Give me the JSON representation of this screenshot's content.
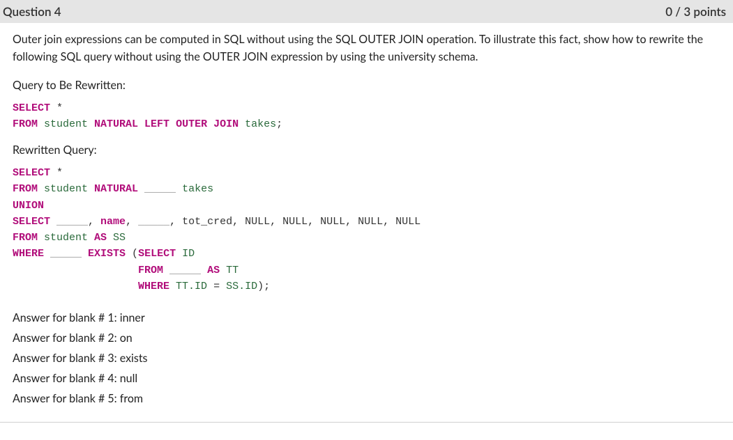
{
  "header": {
    "title": "Question 4",
    "points": "0 / 3 points"
  },
  "prompt": "Outer join expressions can be computed in SQL without using the SQL OUTER JOIN operation.  To illustrate this fact, show how to rewrite the following SQL query without using the OUTER JOIN expression by using the university schema.",
  "labels": {
    "original": "Query to Be Rewritten:",
    "rewritten": "Rewritten Query:"
  },
  "code1": {
    "select": "SELECT",
    "star": " *",
    "from": "FROM",
    "student": " student ",
    "natural": "NATURAL",
    "left": " LEFT",
    "outer": " OUTER",
    "join": " JOIN",
    "takes": " takes",
    "semi": ";"
  },
  "code2": {
    "l1_select": "SELECT",
    "l1_star": " *",
    "l2_from": "FROM",
    "l2_student": " student ",
    "l2_natural": "NATURAL",
    "l2_blank": " _____ ",
    "l2_takes": "takes",
    "l3_union": "UNION",
    "l4_select": "SELECT",
    "l4_blank1": " _____",
    "l4_comma1": ", ",
    "l4_name": "name",
    "l4_comma2": ", ",
    "l4_blank2": "_____",
    "l4_rest": ", tot_cred, NULL, NULL, NULL, NULL, NULL",
    "l5_from": "FROM",
    "l5_student": " student ",
    "l5_as": "AS",
    "l5_ss": " SS",
    "l6_where": "WHERE",
    "l6_blank": " _____ ",
    "l6_exists": "EXISTS",
    "l6_paren": " (",
    "l6_select": "SELECT",
    "l6_id": " ID",
    "l7_pad": "                    ",
    "l7_from": "FROM",
    "l7_blank": " _____ ",
    "l7_as": "AS",
    "l7_tt": " TT",
    "l8_pad": "                    ",
    "l8_where": "WHERE",
    "l8_ttid": " TT.ID ",
    "l8_eq": "=",
    "l8_ssid": " SS.ID",
    "l8_close": ");"
  },
  "answers": [
    "Answer for blank # 1: inner",
    "Answer for blank # 2: on",
    "Answer for blank # 3: exists",
    "Answer for blank # 4: null",
    "Answer for blank # 5: from"
  ]
}
